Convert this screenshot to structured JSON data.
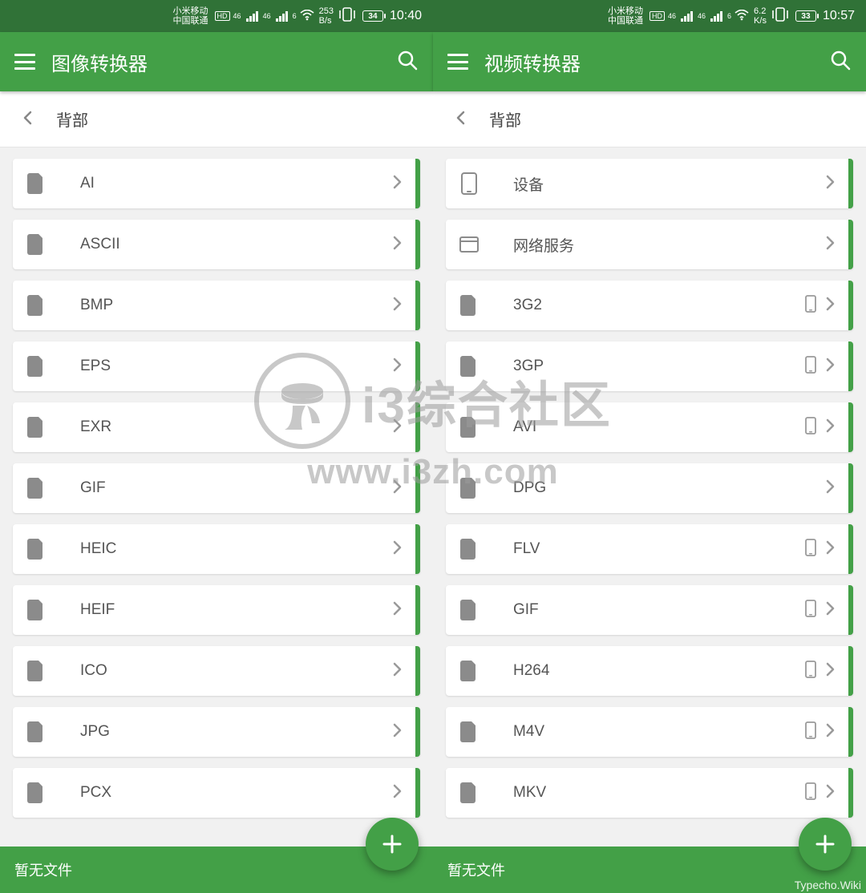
{
  "panes": [
    {
      "status": {
        "carrier1": "小米移动",
        "carrier2": "中国联通",
        "hd": "HD",
        "net1": "46",
        "net2": "46",
        "wifi_strength": "6",
        "rate_value": "253",
        "rate_unit": "B/s",
        "battery": "34",
        "time": "10:40"
      },
      "app_title": "图像转换器",
      "back_label": "背部",
      "items": [
        {
          "label": "AI",
          "icon": "file",
          "device_icon": false
        },
        {
          "label": "ASCII",
          "icon": "file",
          "device_icon": false
        },
        {
          "label": "BMP",
          "icon": "file",
          "device_icon": false
        },
        {
          "label": "EPS",
          "icon": "file",
          "device_icon": false
        },
        {
          "label": "EXR",
          "icon": "file",
          "device_icon": false
        },
        {
          "label": "GIF",
          "icon": "file",
          "device_icon": false
        },
        {
          "label": "HEIC",
          "icon": "file",
          "device_icon": false
        },
        {
          "label": "HEIF",
          "icon": "file",
          "device_icon": false
        },
        {
          "label": "ICO",
          "icon": "file",
          "device_icon": false
        },
        {
          "label": "JPG",
          "icon": "file",
          "device_icon": false
        },
        {
          "label": "PCX",
          "icon": "file",
          "device_icon": false
        }
      ],
      "bottom_text": "暂无文件"
    },
    {
      "status": {
        "carrier1": "小米移动",
        "carrier2": "中国联通",
        "hd": "HD",
        "net1": "46",
        "net2": "46",
        "wifi_strength": "6",
        "rate_value": "6.2",
        "rate_unit": "K/s",
        "battery": "33",
        "time": "10:57"
      },
      "app_title": "视频转换器",
      "back_label": "背部",
      "items": [
        {
          "label": "设备",
          "icon": "phone",
          "device_icon": false
        },
        {
          "label": "网络服务",
          "icon": "web",
          "device_icon": false
        },
        {
          "label": "3G2",
          "icon": "file",
          "device_icon": true
        },
        {
          "label": "3GP",
          "icon": "file",
          "device_icon": true
        },
        {
          "label": "AVI",
          "icon": "file",
          "device_icon": true
        },
        {
          "label": "DPG",
          "icon": "file",
          "device_icon": false
        },
        {
          "label": "FLV",
          "icon": "file",
          "device_icon": true
        },
        {
          "label": "GIF",
          "icon": "file",
          "device_icon": true
        },
        {
          "label": "H264",
          "icon": "file",
          "device_icon": true
        },
        {
          "label": "M4V",
          "icon": "file",
          "device_icon": true
        },
        {
          "label": "MKV",
          "icon": "file",
          "device_icon": true
        }
      ],
      "bottom_text": "暂无文件"
    }
  ],
  "watermark": {
    "title": "i3综合社区",
    "url": "www.i3zh.com"
  },
  "footer_credit": "Typecho.Wiki"
}
